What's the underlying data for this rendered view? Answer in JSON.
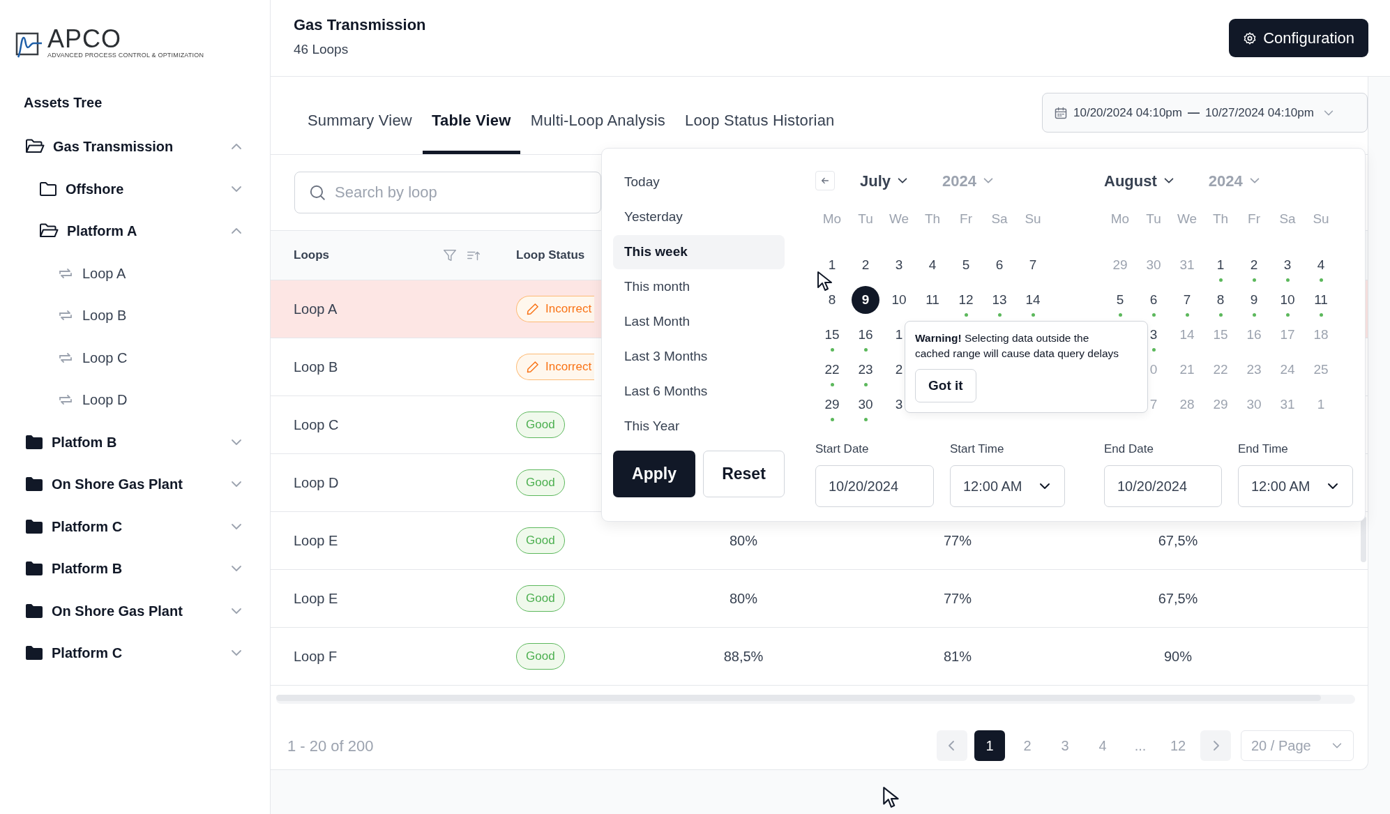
{
  "logo": {
    "name": "APCO",
    "tagline": "ADVANCED PROCESS CONTROL & OPTIMIZATION"
  },
  "sidebar": {
    "title": "Assets Tree",
    "tree": [
      {
        "label": "Gas Transmission",
        "kind": "folder",
        "expanded": true,
        "children": [
          {
            "label": "Offshore",
            "kind": "folder",
            "expanded": false
          },
          {
            "label": "Platform A",
            "kind": "folder",
            "expanded": true,
            "children": [
              {
                "label": "Loop A",
                "kind": "loop"
              },
              {
                "label": "Loop B",
                "kind": "loop"
              },
              {
                "label": "Loop C",
                "kind": "loop"
              },
              {
                "label": "Loop D",
                "kind": "loop"
              }
            ]
          }
        ]
      },
      {
        "label": "Platfom B",
        "kind": "folder-solid",
        "expanded": false
      },
      {
        "label": "On Shore Gas Plant",
        "kind": "folder-solid",
        "expanded": false
      },
      {
        "label": "Platform C",
        "kind": "folder-solid",
        "expanded": false
      },
      {
        "label": "Platform B",
        "kind": "folder-solid",
        "expanded": false
      },
      {
        "label": "On Shore Gas Plant",
        "kind": "folder-solid",
        "expanded": false
      },
      {
        "label": "Platform C",
        "kind": "folder-solid",
        "expanded": false
      }
    ]
  },
  "header": {
    "title": "Gas Transmission",
    "subtitle": "46 Loops",
    "config_button": "Configuration"
  },
  "tabs": [
    {
      "label": "Summary View",
      "selected": false
    },
    {
      "label": "Table View",
      "selected": true
    },
    {
      "label": "Multi-Loop Analysis",
      "selected": false
    },
    {
      "label": "Loop Status Historian",
      "selected": false
    }
  ],
  "date_range": {
    "start": "10/20/2024 04:10pm",
    "separator": "—",
    "end": "10/27/2024 04:10pm"
  },
  "search": {
    "placeholder": "Search by loop"
  },
  "table": {
    "columns": [
      "Loops",
      "Loop Status"
    ],
    "rows": [
      {
        "loop": "Loop A",
        "selected": true,
        "status": {
          "kind": "warning",
          "label": "Incorrect"
        },
        "values": []
      },
      {
        "loop": "Loop B",
        "selected": false,
        "status": {
          "kind": "warning",
          "label": "Incorrect"
        },
        "values": []
      },
      {
        "loop": "Loop C",
        "selected": false,
        "status": {
          "kind": "good",
          "label": "Good"
        },
        "values": []
      },
      {
        "loop": "Loop D",
        "selected": false,
        "status": {
          "kind": "good",
          "label": "Good"
        },
        "values": []
      },
      {
        "loop": "Loop E",
        "selected": false,
        "status": {
          "kind": "good",
          "label": "Good"
        },
        "values": [
          "80%",
          "77%",
          "67,5%"
        ]
      },
      {
        "loop": "Loop E",
        "selected": false,
        "status": {
          "kind": "good",
          "label": "Good"
        },
        "values": [
          "80%",
          "77%",
          "67,5%"
        ]
      },
      {
        "loop": "Loop F",
        "selected": false,
        "status": {
          "kind": "good",
          "label": "Good"
        },
        "values": [
          "88,5%",
          "81%",
          "90%"
        ]
      }
    ]
  },
  "pagination": {
    "summary": "1 - 20 of 200",
    "pages": [
      {
        "label": "1",
        "kind": "page",
        "selected": true
      },
      {
        "label": "2",
        "kind": "page",
        "selected": false
      },
      {
        "label": "3",
        "kind": "page",
        "selected": false
      },
      {
        "label": "4",
        "kind": "page",
        "selected": false
      },
      {
        "label": "...",
        "kind": "ellipsis"
      },
      {
        "label": "12",
        "kind": "page",
        "selected": false
      }
    ],
    "page_size": "20 / Page"
  },
  "date_picker": {
    "presets": [
      {
        "label": "Today",
        "selected": false
      },
      {
        "label": "Yesterday",
        "selected": false
      },
      {
        "label": "This week",
        "selected": true
      },
      {
        "label": "This month",
        "selected": false
      },
      {
        "label": "Last Month",
        "selected": false
      },
      {
        "label": "Last 3 Months",
        "selected": false
      },
      {
        "label": "Last 6 Months",
        "selected": false
      },
      {
        "label": "This Year",
        "selected": false
      }
    ],
    "apply": "Apply",
    "reset": "Reset",
    "months": [
      {
        "month": "July",
        "year": "2024",
        "weekdays": [
          "Mo",
          "Tu",
          "We",
          "Th",
          "Fr",
          "Sa",
          "Su"
        ],
        "weeks": [
          {
            "kind": "full",
            "days": [
              {
                "day": "1",
                "muted": false,
                "dot": false,
                "selected": false
              },
              {
                "day": "2",
                "muted": false,
                "dot": false,
                "selected": false
              },
              {
                "day": "3",
                "muted": false,
                "dot": false,
                "selected": false
              },
              {
                "day": "4",
                "muted": false,
                "dot": false,
                "selected": false
              },
              {
                "day": "5",
                "muted": false,
                "dot": false,
                "selected": false
              },
              {
                "day": "6",
                "muted": false,
                "dot": false,
                "selected": false
              },
              {
                "day": "7",
                "muted": false,
                "dot": false,
                "selected": false
              }
            ]
          },
          {
            "kind": "full",
            "days": [
              {
                "day": "8",
                "muted": false,
                "dot": false,
                "selected": false
              },
              {
                "day": "9",
                "muted": false,
                "dot": false,
                "selected": true
              },
              {
                "day": "10",
                "muted": false,
                "dot": false,
                "selected": false
              },
              {
                "day": "11",
                "muted": false,
                "dot": false,
                "selected": false
              },
              {
                "day": "12",
                "muted": false,
                "dot": true,
                "selected": false
              },
              {
                "day": "13",
                "muted": false,
                "dot": true,
                "selected": false
              },
              {
                "day": "14",
                "muted": false,
                "dot": true,
                "selected": false
              }
            ]
          },
          {
            "kind": "head",
            "days": [
              {
                "day": "15",
                "muted": false,
                "dot": true,
                "selected": false
              },
              {
                "day": "16",
                "muted": false,
                "dot": true,
                "selected": false
              },
              {
                "day": "1",
                "muted": false,
                "dot": false,
                "selected": false
              }
            ]
          },
          {
            "kind": "head",
            "days": [
              {
                "day": "22",
                "muted": false,
                "dot": true,
                "selected": false
              },
              {
                "day": "23",
                "muted": false,
                "dot": true,
                "selected": false
              },
              {
                "day": "2",
                "muted": false,
                "dot": false,
                "selected": false
              }
            ]
          },
          {
            "kind": "head",
            "days": [
              {
                "day": "29",
                "muted": false,
                "dot": true,
                "selected": false
              },
              {
                "day": "30",
                "muted": false,
                "dot": true,
                "selected": false
              },
              {
                "day": "3",
                "muted": false,
                "dot": false,
                "selected": false
              }
            ]
          }
        ]
      },
      {
        "month": "August",
        "year": "2024",
        "weekdays": [
          "Mo",
          "Tu",
          "We",
          "Th",
          "Fr",
          "Sa",
          "Su"
        ],
        "weeks": [
          {
            "kind": "full",
            "days": [
              {
                "day": "29",
                "muted": true,
                "dot": false,
                "selected": false
              },
              {
                "day": "30",
                "muted": true,
                "dot": false,
                "selected": false
              },
              {
                "day": "31",
                "muted": true,
                "dot": false,
                "selected": false
              },
              {
                "day": "1",
                "muted": false,
                "dot": true,
                "selected": false
              },
              {
                "day": "2",
                "muted": false,
                "dot": true,
                "selected": false
              },
              {
                "day": "3",
                "muted": false,
                "dot": true,
                "selected": false
              },
              {
                "day": "4",
                "muted": false,
                "dot": true,
                "selected": false
              }
            ]
          },
          {
            "kind": "full",
            "days": [
              {
                "day": "5",
                "muted": false,
                "dot": true,
                "selected": false
              },
              {
                "day": "6",
                "muted": false,
                "dot": true,
                "selected": false
              },
              {
                "day": "7",
                "muted": false,
                "dot": true,
                "selected": false
              },
              {
                "day": "8",
                "muted": false,
                "dot": true,
                "selected": false
              },
              {
                "day": "9",
                "muted": false,
                "dot": true,
                "selected": false
              },
              {
                "day": "10",
                "muted": false,
                "dot": true,
                "selected": false
              },
              {
                "day": "11",
                "muted": false,
                "dot": true,
                "selected": false
              }
            ]
          },
          {
            "kind": "tail",
            "days": [
              {
                "day": "3",
                "muted": false,
                "dot": true,
                "selected": false
              },
              {
                "day": "14",
                "muted": true,
                "dot": false,
                "selected": false
              },
              {
                "day": "15",
                "muted": true,
                "dot": false,
                "selected": false
              },
              {
                "day": "16",
                "muted": true,
                "dot": false,
                "selected": false
              },
              {
                "day": "17",
                "muted": true,
                "dot": false,
                "selected": false
              },
              {
                "day": "18",
                "muted": true,
                "dot": false,
                "selected": false
              }
            ]
          },
          {
            "kind": "tail",
            "days": [
              {
                "day": "0",
                "muted": true,
                "dot": false,
                "selected": false
              },
              {
                "day": "21",
                "muted": true,
                "dot": false,
                "selected": false
              },
              {
                "day": "22",
                "muted": true,
                "dot": false,
                "selected": false
              },
              {
                "day": "23",
                "muted": true,
                "dot": false,
                "selected": false
              },
              {
                "day": "24",
                "muted": true,
                "dot": false,
                "selected": false
              },
              {
                "day": "25",
                "muted": true,
                "dot": false,
                "selected": false
              }
            ]
          },
          {
            "kind": "tail",
            "days": [
              {
                "day": "7",
                "muted": true,
                "dot": false,
                "selected": false
              },
              {
                "day": "28",
                "muted": true,
                "dot": false,
                "selected": false
              },
              {
                "day": "29",
                "muted": true,
                "dot": false,
                "selected": false
              },
              {
                "day": "30",
                "muted": true,
                "dot": false,
                "selected": false
              },
              {
                "day": "31",
                "muted": true,
                "dot": false,
                "selected": false
              },
              {
                "day": "1",
                "muted": true,
                "dot": false,
                "selected": false
              }
            ]
          }
        ]
      }
    ],
    "fields": [
      {
        "label": "Start Date",
        "value": "10/20/2024",
        "kind": "date"
      },
      {
        "label": "Start Time",
        "value": "12:00 AM",
        "kind": "time"
      },
      {
        "label": "End Date",
        "value": "10/20/2024",
        "kind": "date"
      },
      {
        "label": "End Time",
        "value": "12:00 AM",
        "kind": "time"
      }
    ],
    "warning": {
      "text": "**Warning!** Selecting data outside the cached range will cause data query delays",
      "button": "Got it"
    }
  }
}
